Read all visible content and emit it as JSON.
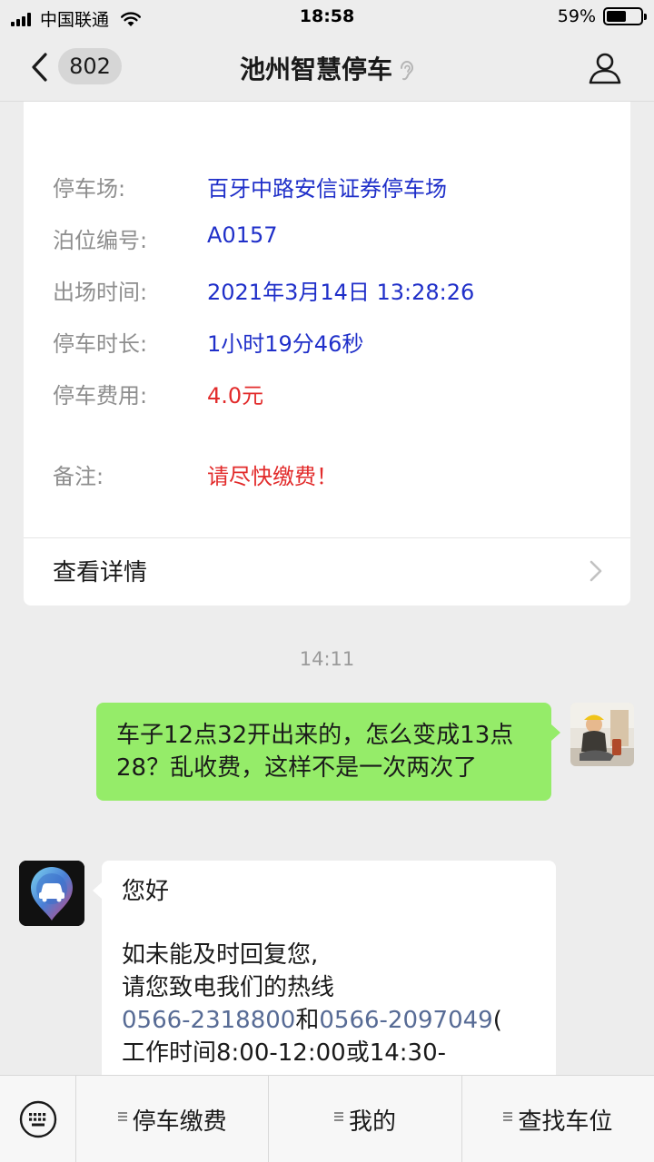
{
  "status_bar": {
    "carrier": "中国联通",
    "time": "18:58",
    "battery_percent": "59%",
    "battery_level": 0.59
  },
  "nav": {
    "unread_count": "802",
    "title": "池州智慧停车"
  },
  "parking_card": {
    "rows": [
      {
        "label": "停车场:",
        "value": "百牙中路安信证券停车场"
      },
      {
        "label": "泊位编号:",
        "value": "A0157"
      },
      {
        "label": "出场时间:",
        "value": "2021年3月14日 13:28:26"
      },
      {
        "label": "停车时长:",
        "value": "1小时19分46秒"
      },
      {
        "label": "停车费用:",
        "value": "4.0元"
      },
      {
        "label": "备注:",
        "value": "请尽快缴费！"
      }
    ],
    "details_link": "查看详情"
  },
  "chat": {
    "timestamp": "14:11",
    "user_message": "车子12点32开出来的，怎么变成13点28？乱收费，这样不是一次两次了",
    "bot_message": {
      "greeting": "您好",
      "line1": "如未能及时回复您,",
      "line2": "请您致电我们的热线",
      "phone1": "0566-2318800",
      "conj": "和",
      "phone2": "0566-2097049",
      "paren": "(",
      "line4": "工作时间8:00-12:00或14:30-"
    }
  },
  "bottom_menu": {
    "items": [
      "停车缴费",
      "我的",
      "查找车位"
    ]
  },
  "colors": {
    "accent_blue": "#1f2fc9",
    "alert_red": "#e22b2b",
    "outgoing_bubble": "#95ec69",
    "link": "#576b95"
  }
}
